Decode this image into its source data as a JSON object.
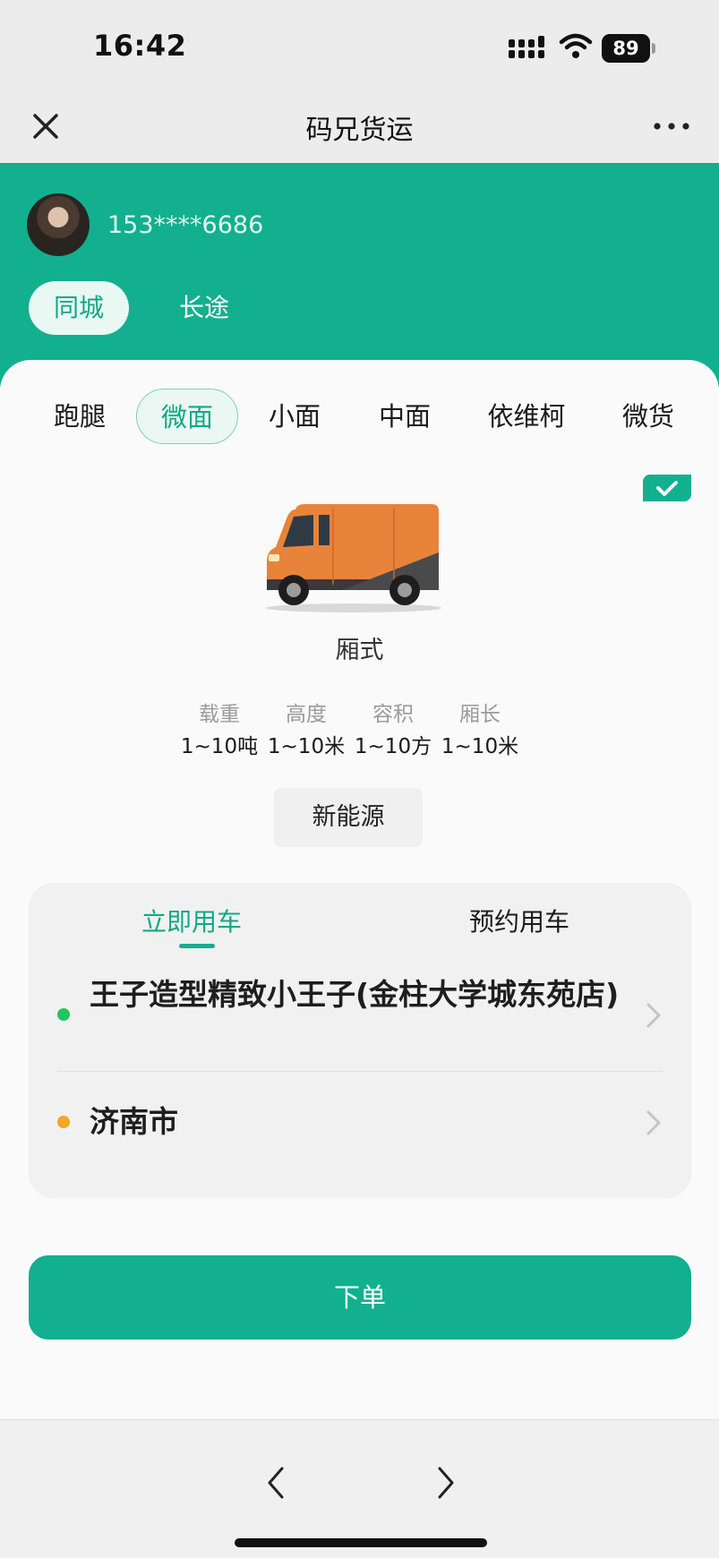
{
  "status_bar": {
    "time": "16:42",
    "battery": "89"
  },
  "nav": {
    "title": "码兄货运"
  },
  "user": {
    "phone": "153****6686"
  },
  "route_tabs": {
    "city": "同城",
    "long_distance": "长途"
  },
  "vehicle_tabs": [
    "跑腿",
    "微面",
    "小面",
    "中面",
    "依维柯",
    "微货"
  ],
  "vehicle_selected": "微面",
  "vehicle": {
    "type": "厢式",
    "specs": [
      {
        "label": "载重",
        "value": "1~10吨"
      },
      {
        "label": "高度",
        "value": "1~10米"
      },
      {
        "label": "容积",
        "value": "1~10方"
      },
      {
        "label": "厢长",
        "value": "1~10米"
      }
    ],
    "energy_label": "新能源",
    "color": "#e8833a"
  },
  "booking": {
    "use_now": "立即用车",
    "reserve": "预约用车",
    "pickup": "王子造型精致小王子(金柱大学城东苑店)",
    "destination": "济南市",
    "pickup_dot_color": "#22c55e",
    "destination_dot_color": "#f5a623"
  },
  "order_button": "下单",
  "colors": {
    "primary": "#12b08f"
  }
}
